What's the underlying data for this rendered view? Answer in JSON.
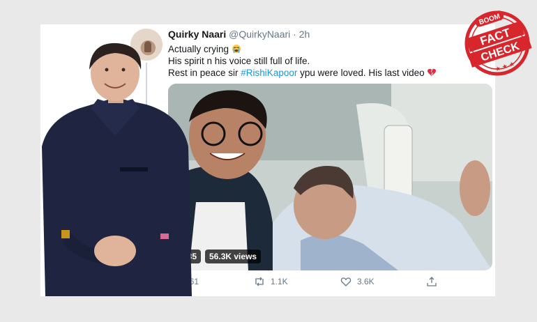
{
  "tweet": {
    "display_name": "Quirky Naari",
    "handle": "@QuirkyNaari",
    "separator": "·",
    "time": "2h",
    "line1": "Actually crying",
    "line2": "His spirit n his voice still full of life.",
    "line3_pre": "Rest in peace sir ",
    "hashtag": "#RishiKapoor",
    "line3_post": " ypu were loved. His last video",
    "emoji1": "loudly-crying-face",
    "emoji2": "broken-heart"
  },
  "video": {
    "duration": "0:35",
    "views": "56.3K views"
  },
  "actions": {
    "replies": "161",
    "retweets": "1.1K",
    "likes": "3.6K"
  },
  "stamp": {
    "top_text": "BOOM",
    "line1": "FACT",
    "line2": "CHECK"
  },
  "colors": {
    "hashtag": "#1b95e0",
    "muted": "#657786",
    "stamp_red": "#d7262c"
  }
}
